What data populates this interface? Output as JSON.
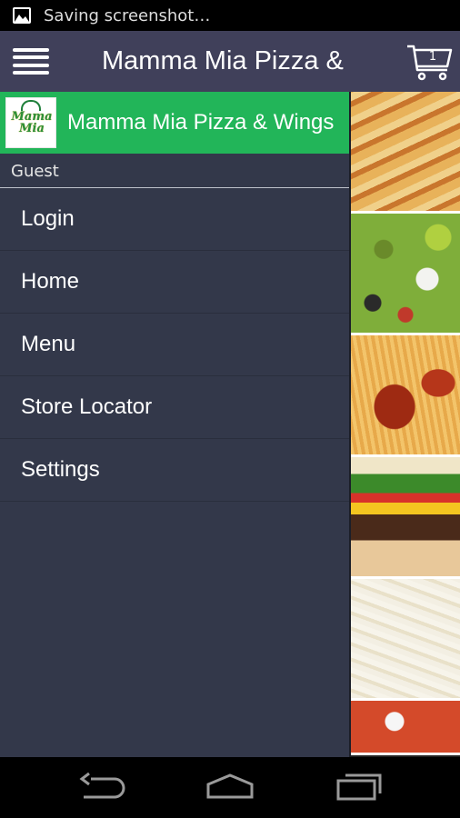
{
  "status_bar": {
    "icon": "image-icon",
    "text": "Saving screenshot…"
  },
  "app_bar": {
    "title": "Mamma Mia Pizza &",
    "menu_icon": "hamburger-menu-icon",
    "cart_icon": "cart-icon",
    "cart_count": "1",
    "background": "#40405a"
  },
  "drawer": {
    "header": {
      "logo_text": "Mama Mia",
      "title": "Mamma Mia Pizza & Wings",
      "background": "#22b559"
    },
    "user_label": "Guest",
    "items": [
      {
        "label": "Login"
      },
      {
        "label": "Home"
      },
      {
        "label": "Menu"
      },
      {
        "label": "Store Locator"
      },
      {
        "label": "Settings"
      }
    ],
    "background": "#33384a"
  },
  "food_images": [
    "breadsticks",
    "greek-salad",
    "buffalo-wings",
    "cheeseburger",
    "fettuccine-alfredo",
    "pizza"
  ],
  "nav_bar": {
    "buttons": [
      "back-icon",
      "home-icon",
      "recent-apps-icon"
    ]
  }
}
